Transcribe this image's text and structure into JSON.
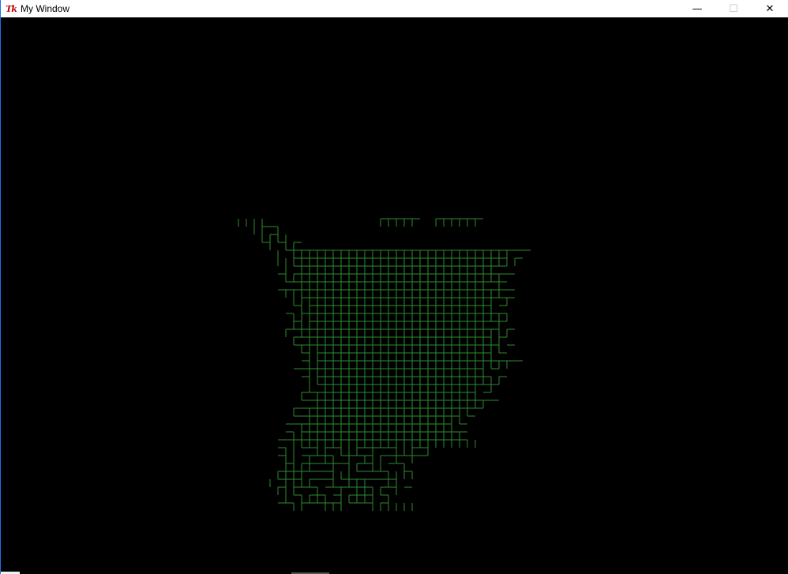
{
  "window": {
    "title": "My Window",
    "icon_name": "tk-feather-icon",
    "icon_glyph": "Tk"
  },
  "controls": {
    "minimize": "—",
    "maximize": "☐",
    "close": "✕"
  },
  "canvas": {
    "background": "#000000",
    "line_color": "#2e8b2e"
  }
}
